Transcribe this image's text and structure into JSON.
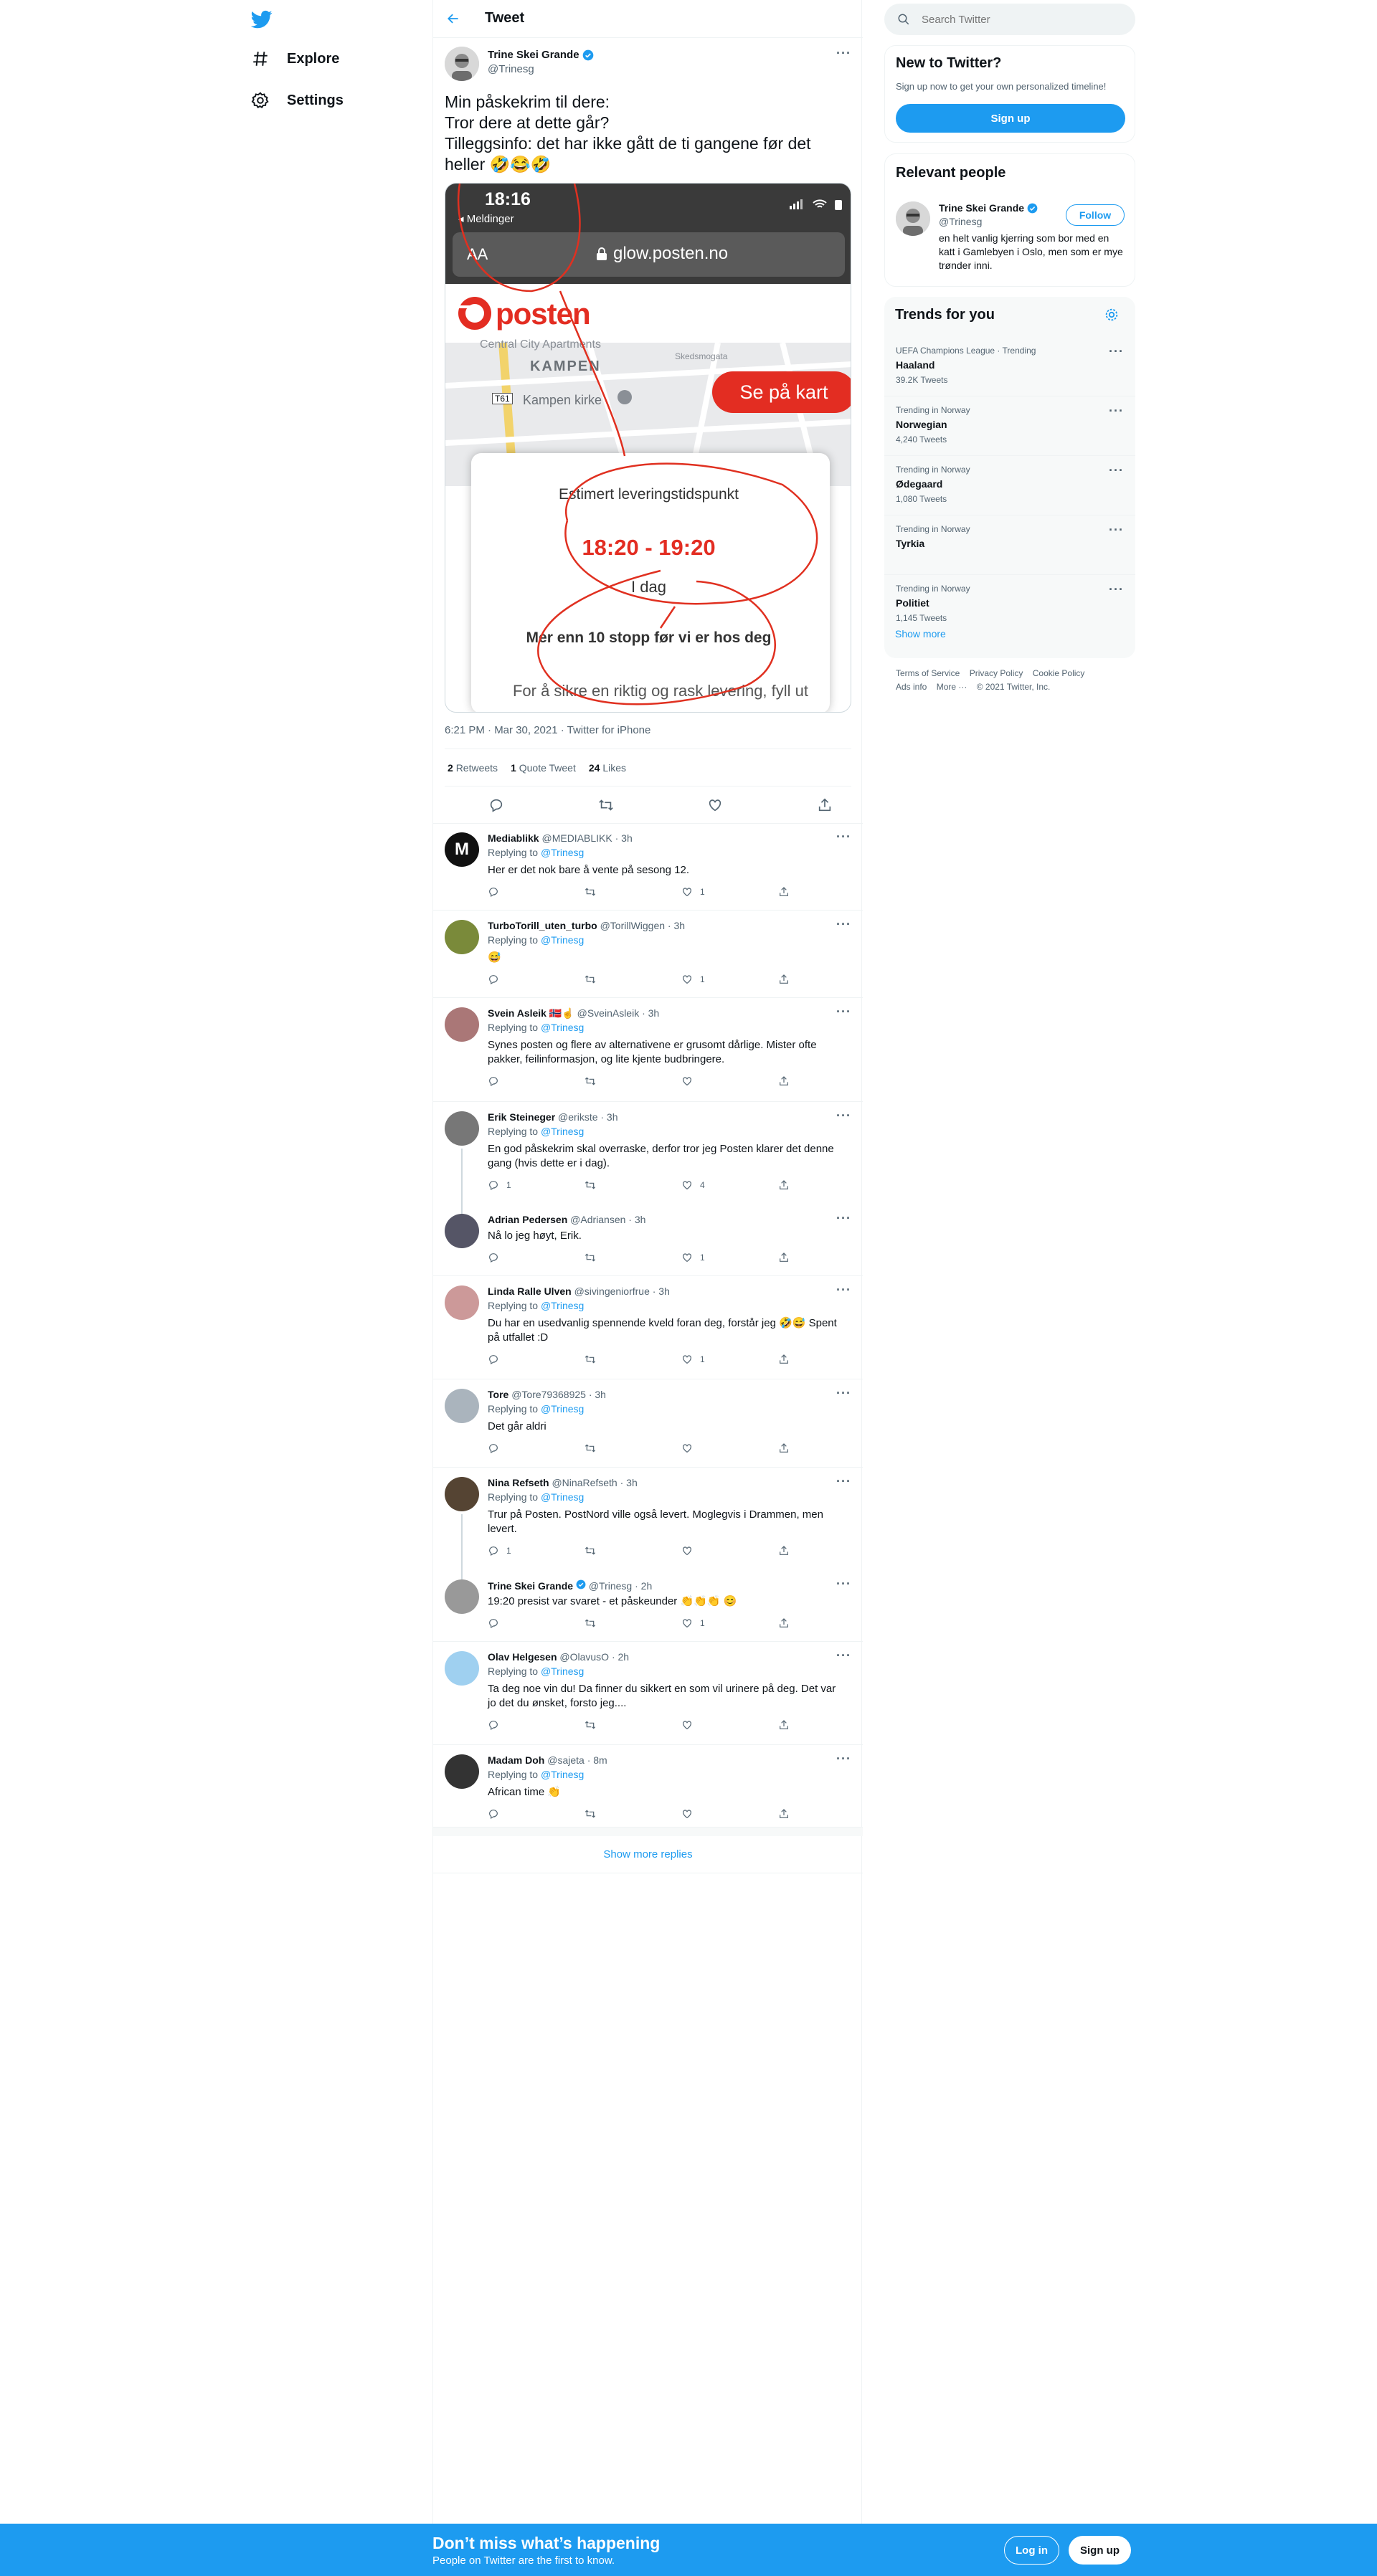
{
  "nav": {
    "explore": "Explore",
    "settings": "Settings"
  },
  "header": {
    "title": "Tweet"
  },
  "tweet": {
    "author_name": "Trine Skei Grande",
    "author_handle": "@Trinesg",
    "text_lines": [
      "Min påskekrim til dere:",
      "Tror dere at dette går?",
      "Tilleggsinfo: det har ikke gått de ti gangene før det heller 🤣😂🤣"
    ],
    "media": {
      "time": "18:16",
      "back": "◂ Meldinger",
      "aa": "AA",
      "url": "glow.posten.no",
      "brand": "posten",
      "map_label1": "KAMPEN",
      "map_label2": "Kampen kirke",
      "map_label3": "Central City Apartments",
      "map_label4": "Skedsmogata",
      "map_badge": "T61",
      "map_button": "Se på kart",
      "est_label": "Estimert leveringstidspunkt",
      "time_window": "18:20 - 19:20",
      "day": "I dag",
      "stops": "Mer enn 10 stopp før vi er hos deg",
      "footer": "For å sikre en riktig og rask levering, fyll ut"
    },
    "meta": "6:21 PM · Mar 30, 2021 · Twitter for iPhone",
    "retweets": "2",
    "retweets_label": "Retweets",
    "quotes": "1",
    "quotes_label": "Quote Tweet",
    "likes": "24",
    "likes_label": "Likes"
  },
  "replies": [
    {
      "name": "Mediablikk",
      "handle": "@MEDIABLIKK · 3h",
      "replying": "Replying to",
      "to": "@Trinesg",
      "text": "Her er det nok bare å vente på sesong 12.",
      "replies": "",
      "likes": "1"
    },
    {
      "name": "TurboTorill_uten_turbo",
      "handle": "@TorillWiggen · 3h",
      "replying": "Replying to",
      "to": "@Trinesg",
      "text": "😅",
      "replies": "",
      "likes": "1"
    },
    {
      "name": "Svein Asleik 🇳🇴☝",
      "handle": "@SveinAsleik · 3h",
      "replying": "Replying to",
      "to": "@Trinesg",
      "text": "Synes posten og flere av alternativene er grusomt dårlige. Mister ofte pakker, feilinformasjon, og lite kjente budbringere.",
      "replies": "",
      "likes": ""
    },
    {
      "name": "Erik Steineger",
      "handle": "@erikste · 3h",
      "replying": "Replying to",
      "to": "@Trinesg",
      "text": "En god påskekrim skal overraske, derfor tror jeg Posten klarer det denne gang (hvis dette er i dag).",
      "replies": "1",
      "likes": "4"
    },
    {
      "name": "Adrian Pedersen",
      "handle": "@Adriansen · 3h",
      "text": "Nå lo jeg høyt, Erik.",
      "replies": "",
      "likes": "1"
    },
    {
      "name": "Linda Ralle Ulven",
      "handle": "@sivingeniorfrue · 3h",
      "replying": "Replying to",
      "to": "@Trinesg",
      "text": "Du har en usedvanlig spennende kveld foran deg, forstår jeg 🤣😅 Spent på utfallet :D",
      "replies": "",
      "likes": "1"
    },
    {
      "name": "Tore",
      "handle": "@Tore79368925 · 3h",
      "replying": "Replying to",
      "to": "@Trinesg",
      "text": "Det går aldri",
      "replies": "",
      "likes": ""
    },
    {
      "name": "Nina Refseth",
      "handle": "@NinaRefseth · 3h",
      "replying": "Replying to",
      "to": "@Trinesg",
      "text": "Trur på Posten. PostNord ville også levert. Moglegvis i Drammen, men levert.",
      "replies": "1",
      "likes": ""
    },
    {
      "name": "Trine Skei Grande",
      "handle": "@Trinesg · 2h",
      "text": "19:20 presist var svaret - et påskeunder 👏👏👏 😊",
      "replies": "",
      "likes": "1"
    },
    {
      "name": "Olav Helgesen",
      "handle": "@OlavusO · 2h",
      "replying": "Replying to",
      "to": "@Trinesg",
      "text": "Ta deg noe vin du! Da finner du sikkert en som vil urinere på deg. Det var jo det du ønsket, forsto jeg....",
      "replies": "",
      "likes": ""
    },
    {
      "name": "Madam Doh",
      "handle": "@sajeta · 8m",
      "replying": "Replying to",
      "to": "@Trinesg",
      "text": "African time 👏",
      "replies": "",
      "likes": ""
    }
  ],
  "show_more_replies": "Show more replies",
  "search": {
    "placeholder": "Search Twitter"
  },
  "new_to_twitter": {
    "title": "New to Twitter?",
    "subtitle": "Sign up now to get your own personalized timeline!",
    "signup": "Sign up"
  },
  "relevant": {
    "title": "Relevant people",
    "name": "Trine Skei Grande",
    "handle": "@Trinesg",
    "follow": "Follow",
    "bio": "en helt vanlig kjerring som bor med en katt i Gamlebyen i Oslo, men som er mye trønder inni."
  },
  "trends": {
    "title": "Trends for you",
    "items": [
      {
        "category": "UEFA Champions League · Trending",
        "name": "Haaland",
        "count": "39.2K Tweets"
      },
      {
        "category": "Trending in Norway",
        "name": "Norwegian",
        "count": "4,240 Tweets"
      },
      {
        "category": "Trending in Norway",
        "name": "Ødegaard",
        "count": "1,080 Tweets"
      },
      {
        "category": "Trending in Norway",
        "name": "Tyrkia",
        "count": ""
      },
      {
        "category": "Trending in Norway",
        "name": "Politiet",
        "count": "1,145 Tweets"
      }
    ],
    "show_more": "Show more"
  },
  "footer": {
    "links": [
      "Terms of Service",
      "Privacy Policy",
      "Cookie Policy",
      "Ads info",
      "More ···"
    ],
    "copyright": "© 2021 Twitter, Inc."
  },
  "banner": {
    "title": "Don’t miss what’s happening",
    "subtitle": "People on Twitter are the first to know.",
    "login": "Log in",
    "signup": "Sign up"
  },
  "colors": {
    "accent": "#1d9bf0",
    "posten_red": "#e32d22",
    "text": "#0f1419",
    "muted": "#536471"
  }
}
